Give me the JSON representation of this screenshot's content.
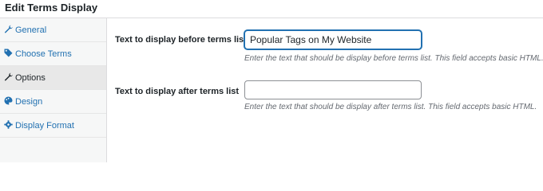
{
  "window": {
    "title": "Edit Terms Display"
  },
  "colors": {
    "accent": "#2271b1",
    "active_bg": "#e8e8e8",
    "sidebar_bg": "#f6f7f7",
    "description": "#646970"
  },
  "sidebar": {
    "items": [
      {
        "label": "General",
        "icon": "wrench-icon",
        "active": false
      },
      {
        "label": "Choose Terms",
        "icon": "tag-icon",
        "active": false
      },
      {
        "label": "Options",
        "icon": "wrench-icon",
        "active": true
      },
      {
        "label": "Design",
        "icon": "palette-icon",
        "active": false
      },
      {
        "label": "Display Format",
        "icon": "gear-icon",
        "active": false
      }
    ]
  },
  "form": {
    "before": {
      "label": "Text to display before terms list",
      "value": "Popular Tags on My Website",
      "placeholder": "",
      "description": "Enter the text that should be display before terms list. This field accepts basic HTML."
    },
    "after": {
      "label": "Text to display after terms list",
      "value": "",
      "placeholder": "",
      "description": "Enter the text that should be display after terms list. This field accepts basic HTML."
    }
  }
}
